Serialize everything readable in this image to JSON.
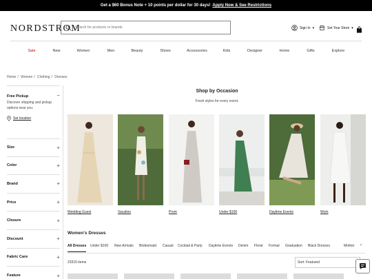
{
  "promo": {
    "text": "Get a $60 Bonus Note + 10 points per dollar for 30 days!",
    "link": "Apply Now & See Restrictions"
  },
  "header": {
    "logo": "NORDSTROM",
    "search_placeholder": "Search for products or brands",
    "sign_in": "Sign In",
    "store": "Set Your Store",
    "bag_count": "0",
    "icons": [
      "search-icon",
      "user-icon",
      "store-icon",
      "shopping-bag-icon"
    ]
  },
  "nav": [
    "Sale",
    "New",
    "Women",
    "Men",
    "Beauty",
    "Shoes",
    "Accessories",
    "Kids",
    "Designer",
    "Home",
    "Gifts",
    "Explore"
  ],
  "breadcrumb": [
    "Home",
    "Women",
    "Clothing",
    "Dresses"
  ],
  "sidebar": {
    "free_pickup": "Free Pickup",
    "pickup_text": "Discover shipping and pickup options near you.",
    "set_location": "Set location",
    "facets": [
      "Size",
      "Color",
      "Brand",
      "Price",
      "Closure",
      "Discount",
      "Fabric Care",
      "Feature"
    ]
  },
  "occasion": {
    "title": "Shop by Occasion",
    "subtitle": "Fresh styles for every event.",
    "cards": [
      {
        "label": "Wedding Guest",
        "bg": "#ede7dd",
        "dress": "#e6d5b4"
      },
      {
        "label": "Vacation",
        "bg": "#4f6b3a",
        "dress": "#f0efe6"
      },
      {
        "label": "Prom",
        "bg": "#f2f2f0",
        "dress": "#cfcac4"
      },
      {
        "label": "Under $100",
        "bg": "#ecefee",
        "dress": "#3f7f52"
      },
      {
        "label": "Daytime Events",
        "bg": "#4e6b3a",
        "dress": "#e8e4dc"
      },
      {
        "label": "Work",
        "bg": "#eeeeec",
        "dress": "#f7f7f5"
      }
    ]
  },
  "womens_dresses": {
    "title": "Women's Dresses",
    "tabs": [
      "All Dresses",
      "Under $100",
      "New Arrivals",
      "Bridesmaid",
      "Casual",
      "Cocktail & Party",
      "Daytime Events",
      "Denim",
      "Floral",
      "Formal",
      "Graduation",
      "Black Dresses",
      "Mother"
    ],
    "active_tab": "All Dresses",
    "item_count": "23315 items",
    "sort": "Sort: Featured"
  },
  "colors": {
    "sale": "#cc0000",
    "promo_bg": "#000000",
    "text": "#393939"
  }
}
